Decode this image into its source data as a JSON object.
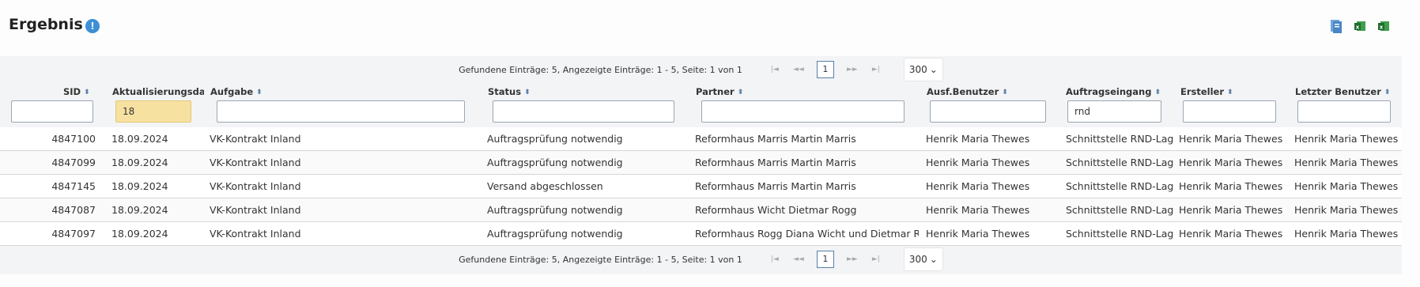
{
  "header": {
    "title": "Ergebnis",
    "info_icon": "info-icon",
    "export_icons": [
      "pdf-export-icon",
      "excel-export-icon",
      "excel-export-all-icon"
    ]
  },
  "pager": {
    "info": "Gefundene Einträge: 5, Angezeigte Einträge: 1 - 5, Seite: 1 von 1",
    "first": "|◄",
    "prev": "◄◄",
    "current_page": "1",
    "next": "►►",
    "last": "►|",
    "page_size": "300"
  },
  "columns": [
    {
      "label": "SID"
    },
    {
      "label": "Aktualisierungsdat"
    },
    {
      "label": "Aufgabe"
    },
    {
      "label": "Status"
    },
    {
      "label": "Partner"
    },
    {
      "label": "Ausf.Benutzer"
    },
    {
      "label": "Auftragseingang"
    },
    {
      "label": "Ersteller"
    },
    {
      "label": "Letzter Benutzer"
    }
  ],
  "filters": {
    "sid": "",
    "aktualisierungsdatum": "18",
    "aufgabe": "",
    "status": "",
    "partner": "",
    "ausf_benutzer": "",
    "auftragseingang": "rnd",
    "ersteller": "",
    "letzter_benutzer": ""
  },
  "rows": [
    {
      "sid": "4847100",
      "datum": "18.09.2024",
      "aufgabe": "VK-Kontrakt Inland",
      "status": "Auftragsprüfung notwendig",
      "partner": "Reformhaus Marris Martin Marris",
      "ausf": "Henrik Maria Thewes",
      "eingang": "Schnittstelle RND-Lager",
      "ersteller": "Henrik Maria Thewes",
      "letzter": "Henrik Maria Thewes"
    },
    {
      "sid": "4847099",
      "datum": "18.09.2024",
      "aufgabe": "VK-Kontrakt Inland",
      "status": "Auftragsprüfung notwendig",
      "partner": "Reformhaus Marris Martin Marris",
      "ausf": "Henrik Maria Thewes",
      "eingang": "Schnittstelle RND-Lager",
      "ersteller": "Henrik Maria Thewes",
      "letzter": "Henrik Maria Thewes"
    },
    {
      "sid": "4847145",
      "datum": "18.09.2024",
      "aufgabe": "VK-Kontrakt Inland",
      "status": "Versand abgeschlossen",
      "partner": "Reformhaus Marris Martin Marris",
      "ausf": "Henrik Maria Thewes",
      "eingang": "Schnittstelle RND-Lager",
      "ersteller": "Henrik Maria Thewes",
      "letzter": "Henrik Maria Thewes"
    },
    {
      "sid": "4847087",
      "datum": "18.09.2024",
      "aufgabe": "VK-Kontrakt Inland",
      "status": "Auftragsprüfung notwendig",
      "partner": "Reformhaus Wicht Dietmar Rogg",
      "ausf": "Henrik Maria Thewes",
      "eingang": "Schnittstelle RND-Lager",
      "ersteller": "Henrik Maria Thewes",
      "letzter": "Henrik Maria Thewes"
    },
    {
      "sid": "4847097",
      "datum": "18.09.2024",
      "aufgabe": "VK-Kontrakt Inland",
      "status": "Auftragsprüfung notwendig",
      "partner": "Reformhaus Rogg Diana Wicht und Dietmar Rogg",
      "ausf": "Henrik Maria Thewes",
      "eingang": "Schnittstelle RND-Lager",
      "ersteller": "Henrik Maria Thewes",
      "letzter": "Henrik Maria Thewes"
    }
  ],
  "colors": {
    "accent": "#3d8fd6",
    "filter_highlight": "#f7e1a0",
    "grid_bg": "#f3f4f6"
  }
}
